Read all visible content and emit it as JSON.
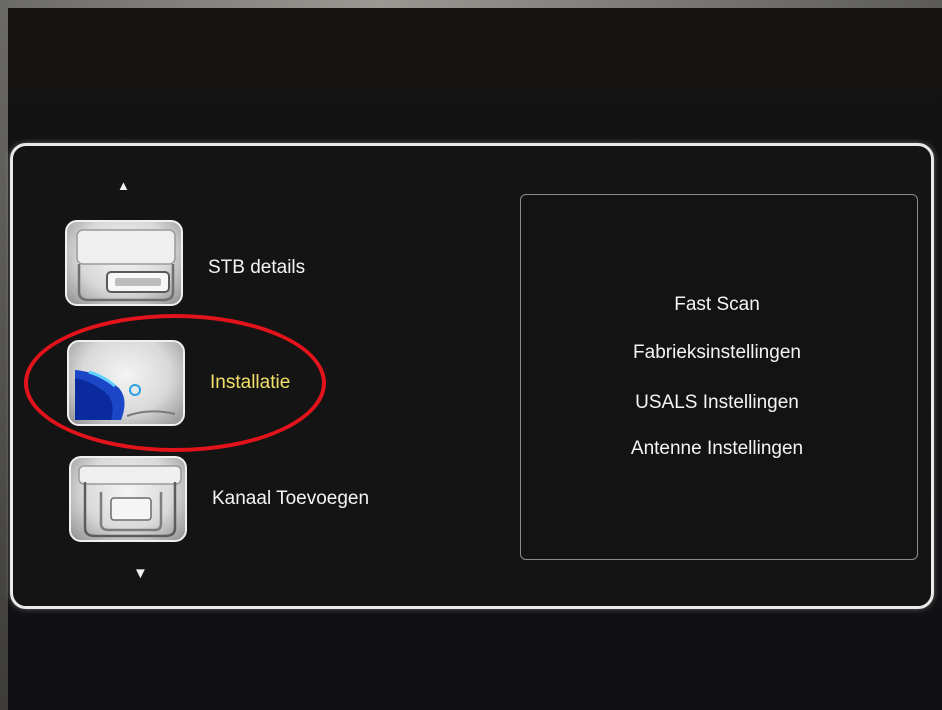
{
  "menu": {
    "items": [
      {
        "label": "STB details",
        "icon": "stb-details-icon",
        "selected": false
      },
      {
        "label": "Installatie",
        "icon": "satellite-dish-icon",
        "selected": true
      },
      {
        "label": "Kanaal Toevoegen",
        "icon": "add-channel-icon",
        "selected": false
      }
    ],
    "scroll_up": "▲",
    "scroll_down": "▼"
  },
  "submenu": {
    "options": [
      {
        "label": "Fast Scan"
      },
      {
        "label": "Fabrieksinstellingen"
      },
      {
        "label": "USALS Instellingen"
      },
      {
        "label": "Antenne Instellingen"
      }
    ]
  },
  "colors": {
    "selected_label": "#f2e06a",
    "highlight_ring": "#e3131b",
    "panel_border": "#e9e9e9"
  }
}
